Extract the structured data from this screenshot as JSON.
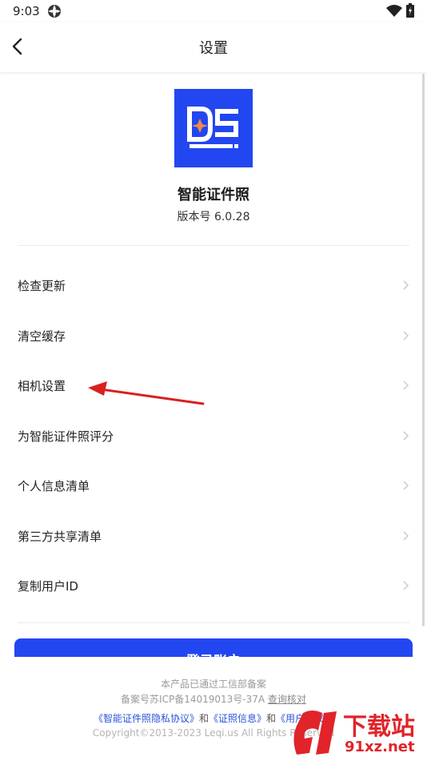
{
  "status_bar": {
    "time": "9:03"
  },
  "nav": {
    "title": "设置"
  },
  "app": {
    "name": "智能证件照",
    "version": "版本号 6.0.28"
  },
  "colors": {
    "brand": "#2247f0",
    "logo_dot": "#f08a4a",
    "arrow": "#d92020",
    "watermark": "#e0242a"
  },
  "settings": [
    {
      "label": "检查更新"
    },
    {
      "label": "清空缓存"
    },
    {
      "label": "相机设置"
    },
    {
      "label": "为智能证件照评分"
    },
    {
      "label": "个人信息清单"
    },
    {
      "label": "第三方共享清单"
    },
    {
      "label": "复制用户ID"
    }
  ],
  "login_button": "登录账户",
  "footer": {
    "line1": "本产品已通过工信部备案",
    "record_no": "备案号苏ICP备14019013号-37A",
    "verify_link": "查询核对",
    "privacy_link": "《智能证件照隐私协议》",
    "and": "和",
    "license_link": "《证照信息》",
    "user_agreement_link": "《用户协议》",
    "copyright": "Copyright©2013-2023 Leqi.us All Rights Reserved"
  },
  "watermark": {
    "text": "下载站",
    "url_text": "91xz.net"
  },
  "icons": [
    "app-status-icon",
    "wifi-icon",
    "battery-icon",
    "back-arrow-icon",
    "chevron-right-icon",
    "annotation-arrow"
  ]
}
